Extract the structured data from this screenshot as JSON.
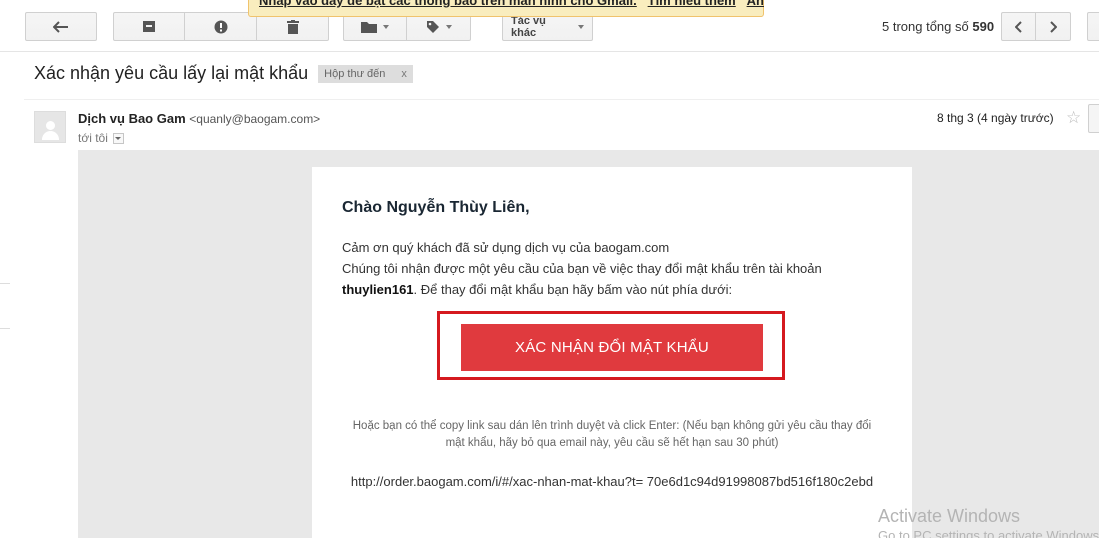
{
  "banner": {
    "text": "Nhấp vào đây để bật các thông báo trên màn hình cho Gmail.",
    "learn_more": "Tìm hiểu thêm",
    "hide": "Ẩn"
  },
  "toolbar": {
    "more_label": "Tác vụ khác",
    "pager": {
      "prefix": "5 trong tổng số",
      "total": "590"
    }
  },
  "subject": {
    "title": "Xác nhận yêu cầu lấy lại mật khẩu",
    "label": "Hộp thư đến",
    "label_remove": "x"
  },
  "sender": {
    "name": "Dịch vụ Bao Gam",
    "email": "<quanly@baogam.com>",
    "to": "tới tôi",
    "date": "8 thg 3 (4 ngày trước)"
  },
  "email": {
    "greeting": "Chào Nguyễn Thùy Liên,",
    "line1": "Cảm ơn quý khách đã sử dụng dịch vụ của baogam.com",
    "line2": "Chúng tôi nhận được một yêu cầu của bạn về việc thay đổi mật khẩu trên tài khoản",
    "username": "thuylien161",
    "line3": ". Để thay đổi mật khẩu bạn hãy bấm vào nút phía dưới:",
    "button": "XÁC NHẬN ĐỔI MẬT KHẨU",
    "note": "Hoặc bạn có thể copy link sau dán lên trình duyệt và click Enter: (Nếu bạn không gửi yêu cầu thay đổi mật khẩu, hãy bỏ qua email này, yêu cầu sẽ hết hạn sau 30 phút)",
    "link": "http://order.baogam.com/i/#/xac-nhan-mat-khau?t= 70e6d1c94d91998087bd516f180c2ebd"
  },
  "watermark": {
    "title": "Activate Windows",
    "subtitle": "Go to PC settings to activate Windows."
  }
}
